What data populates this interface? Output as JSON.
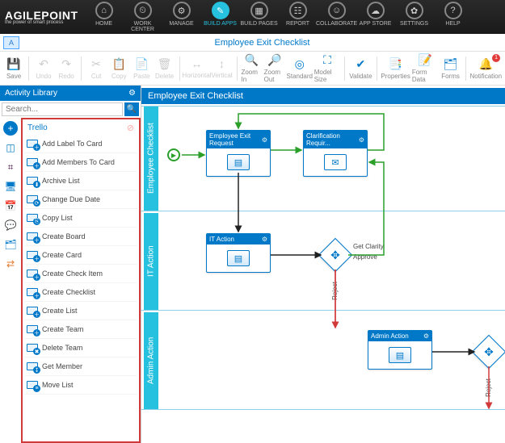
{
  "topnav": {
    "brand": "AGILEPOINT",
    "tagline": "the power of smart process",
    "items": [
      {
        "label": "HOME",
        "icon": "⌂"
      },
      {
        "label": "WORK CENTER",
        "icon": "⏲"
      },
      {
        "label": "MANAGE",
        "icon": "⚙"
      },
      {
        "label": "BUILD APPS",
        "icon": "✎",
        "active": true
      },
      {
        "label": "BUILD PAGES",
        "icon": "▦"
      },
      {
        "label": "REPORT",
        "icon": "☷"
      },
      {
        "label": "COLLABORATE",
        "icon": "☺"
      },
      {
        "label": "APP STORE",
        "icon": "☁"
      },
      {
        "label": "SETTINGS",
        "icon": "✿"
      },
      {
        "label": "HELP",
        "icon": "?"
      }
    ]
  },
  "titlebar": {
    "title": "Employee Exit Checklist"
  },
  "toolbar": {
    "items": [
      {
        "label": "Save",
        "icon": "💾",
        "cls": "save accent"
      },
      {
        "sep": true
      },
      {
        "label": "Undo",
        "icon": "↶",
        "cls": "disabled"
      },
      {
        "label": "Redo",
        "icon": "↷",
        "cls": "disabled"
      },
      {
        "sep": true
      },
      {
        "label": "Cut",
        "icon": "✂",
        "cls": "disabled"
      },
      {
        "label": "Copy",
        "icon": "📋",
        "cls": "disabled"
      },
      {
        "label": "Paste",
        "icon": "📄",
        "cls": "disabled"
      },
      {
        "label": "Delete",
        "icon": "🗑",
        "cls": "disabled"
      },
      {
        "sep": true
      },
      {
        "label": "Horizontal",
        "icon": "↔",
        "cls": "disabled"
      },
      {
        "label": "Vertical",
        "icon": "↕",
        "cls": "disabled"
      },
      {
        "sep": true
      },
      {
        "label": "Zoom In",
        "icon": "🔍",
        "cls": "accent"
      },
      {
        "label": "Zoom Out",
        "icon": "🔎",
        "cls": "accent"
      },
      {
        "label": "Standard",
        "icon": "◎",
        "cls": "accent"
      },
      {
        "label": "Model Size",
        "icon": "⛶",
        "cls": "accent wide"
      },
      {
        "sep": true
      },
      {
        "label": "Validate",
        "icon": "✔",
        "cls": "accent"
      },
      {
        "sep": true
      },
      {
        "label": "Properties",
        "icon": "📑",
        "cls": "accent wide"
      },
      {
        "label": "Form Data",
        "icon": "📝",
        "cls": "accent wide"
      },
      {
        "label": "Forms",
        "icon": "🗂",
        "cls": "accent"
      },
      {
        "sep": true
      },
      {
        "label": "Notification",
        "icon": "🔔",
        "cls": "accent wide",
        "badge": "1"
      }
    ]
  },
  "library": {
    "title": "Activity Library",
    "search_placeholder": "Search...",
    "strip": [
      {
        "name": "add",
        "glyph": "+",
        "cls": "add"
      },
      {
        "name": "trello",
        "glyph": "◫",
        "color": "#0079bf"
      },
      {
        "name": "slack",
        "glyph": "⌗",
        "color": "#4a154b"
      },
      {
        "name": "monitor",
        "glyph": "🖥",
        "color": "#0078c8"
      },
      {
        "name": "calendar",
        "glyph": "📅",
        "color": "#0078c8"
      },
      {
        "name": "chat",
        "glyph": "💬",
        "color": "#e8a33d"
      },
      {
        "name": "cards",
        "glyph": "🗂",
        "color": "#0078c8"
      },
      {
        "name": "flow",
        "glyph": "⇄",
        "color": "#e07b2e"
      }
    ],
    "category": "Trello",
    "activities": [
      {
        "label": "Add Label To Card",
        "ov": "＋"
      },
      {
        "label": "Add Members To Card",
        "ov": "＋"
      },
      {
        "label": "Archive List",
        "ov": "⬇"
      },
      {
        "label": "Change Due Date",
        "ov": "⟳"
      },
      {
        "label": "Copy List",
        "ov": "⎘"
      },
      {
        "label": "Create Board",
        "ov": "＋"
      },
      {
        "label": "Create Card",
        "ov": "＋"
      },
      {
        "label": "Create Check Item",
        "ov": "＋"
      },
      {
        "label": "Create Checklist",
        "ov": "＋"
      },
      {
        "label": "Create List",
        "ov": "＋"
      },
      {
        "label": "Create Team",
        "ov": "＋"
      },
      {
        "label": "Delete Team",
        "ov": "✖"
      },
      {
        "label": "Get Member",
        "ov": "↧"
      },
      {
        "label": "Move List",
        "ov": "≡"
      }
    ]
  },
  "canvas": {
    "header": "Employee Exit Checklist",
    "lanes": [
      {
        "label": "Employee Checklist"
      },
      {
        "label": "IT Action"
      },
      {
        "label": "Admin Action"
      }
    ],
    "nodes": {
      "n1": "Employee Exit Request",
      "n2": "Clarification Requir...",
      "n3": "IT Action",
      "n4": "Admin Action"
    },
    "edge_labels": {
      "reject1": "Reject",
      "reject2": "Reject",
      "clarity": "Get Clarity",
      "approve": "Approve"
    }
  }
}
